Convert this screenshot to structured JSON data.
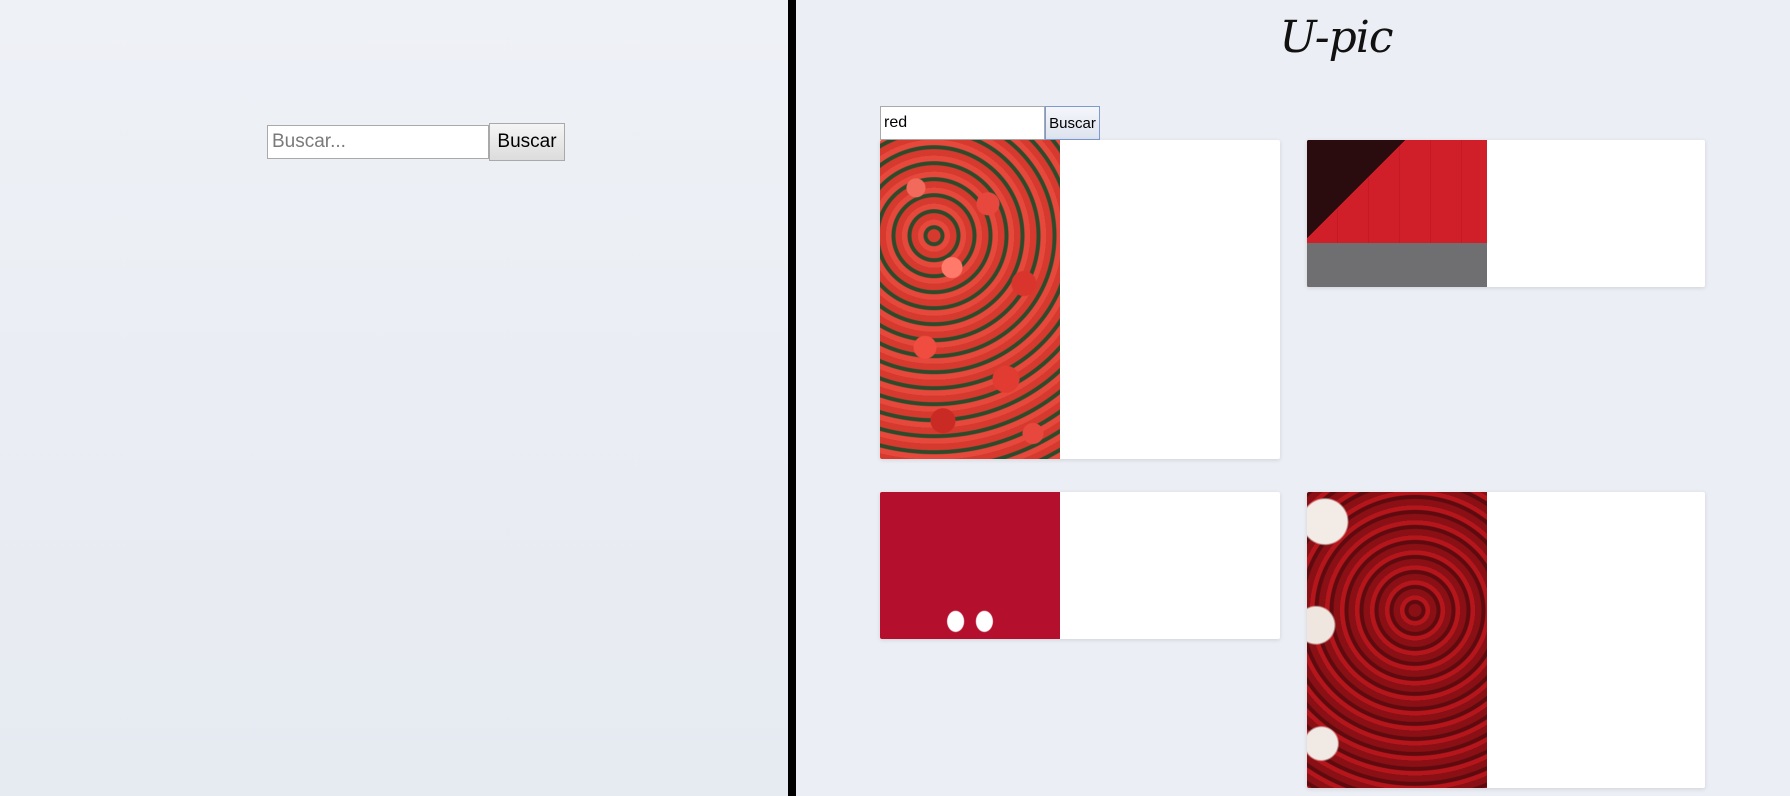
{
  "left": {
    "search": {
      "placeholder": "Buscar...",
      "button_label": "Buscar"
    }
  },
  "right": {
    "brand": "U-pic",
    "search": {
      "value": "red",
      "button_label": "Buscar"
    },
    "results": [
      {
        "image": "red-flowers-field"
      },
      {
        "image": "red-wall-pavement"
      },
      {
        "image": "white-shoes-red-floor"
      },
      {
        "image": "dark-red-flower-tree"
      }
    ]
  }
}
